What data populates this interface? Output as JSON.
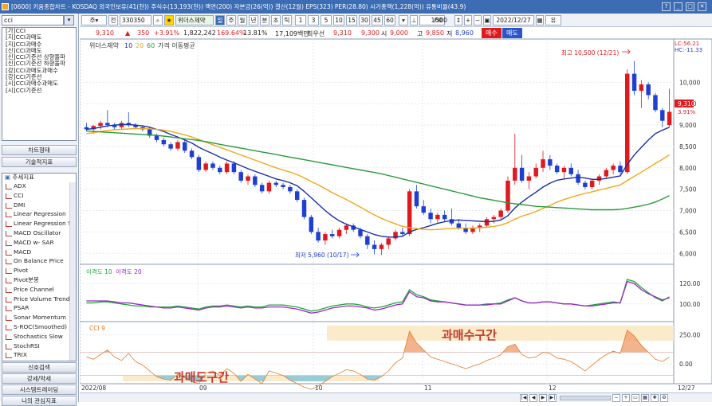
{
  "window": {
    "title": "[0600] 키움종합차트 - KOSDAQ 외국인보유(41(천)) 주식수(13,193(천)) 액면(200) 자본금(26(억)) 결산(12월) EPS(323) PER(28.80) 시가총액(1,228(억)) 유통비율(43.9)",
    "controls": [
      "?",
      "_",
      "□",
      "✕"
    ]
  },
  "sidebar": {
    "search_value": "cci",
    "condition_items": [
      "[가]CCI",
      "[지]CCI과매도",
      "[지]CCI과매수",
      "[신]CCI과매도",
      "[신]CCI기준선 상향돌파",
      "[신]CCI기준선 하향돌파",
      "[강]CCI과매도과매수",
      "[강]CCI기준선",
      "[시]CCI과매수과매도",
      "[시]CCI기준선"
    ],
    "chart_type_label": "차트형태",
    "tech_label": "기술적지표",
    "trend_header": "추세지표",
    "indicators": [
      "ADX",
      "CCI",
      "DMI",
      "Linear Regression",
      "Linear Regression Slope",
      "MACD Oscillator",
      "MACD w- SAR",
      "MACD",
      "On Balance Price",
      "Pivot",
      "Pivot분봉",
      "Price Channel",
      "Price Volume Trend",
      "PSAR",
      "Sonar Momentum",
      "S-ROC(Smoothed)",
      "Stochastics Slow",
      "StochRSI",
      "TRIX"
    ],
    "bottom_buttons": [
      "신호검색",
      "강세/약세",
      "시스템트레이딩",
      "나의 관심지표"
    ]
  },
  "toolbar": {
    "code": "330350",
    "name": "위더스제약",
    "periods": [
      "주",
      "월",
      "년",
      "분",
      "초",
      "틱"
    ],
    "intervals": [
      "1",
      "3",
      "5",
      "10",
      "15",
      "30",
      "45",
      "60"
    ],
    "count": "100",
    "count_total": "/500",
    "date": "2022/12/27",
    "right_label": "유"
  },
  "quote": {
    "price": "9,310",
    "change": "350",
    "change_pct": "+3.91%",
    "volume": "1,822,242",
    "vol_ratio": "169.64%",
    "turnover": "13.81%",
    "amount": "17,109백만",
    "ask_label": "최우선",
    "ask": "9,310",
    "bid": "9,300",
    "open_label": "시",
    "open": "9,000",
    "high_label": "고",
    "high": "9,850",
    "low_label": "저",
    "low": "8,960",
    "buy_label": "매수",
    "sell_label": "매도"
  },
  "price_panel": {
    "legend_name": "위더스제약",
    "legend_ma": [
      "10",
      "20",
      "60"
    ],
    "legend_ma_label": "가격 이동평균",
    "max_label": "최고 10,500 (12/21)",
    "min_label": "최저 5,960 (10/17)",
    "lc_label": "LC:56.21",
    "hc_label": "HC:-11.33",
    "current_price": "9,310",
    "current_pct": "3.91%",
    "ma_colors": {
      "ma10": "#1a2fa8",
      "ma20": "#f0a818",
      "ma60": "#2a9a3a"
    }
  },
  "disp_panel": {
    "legend": [
      "이격도 10",
      "이격도 20"
    ],
    "colors": {
      "d10": "#20a838",
      "d20": "#9b28c8"
    }
  },
  "cci_panel": {
    "legend": "CCI 9",
    "overbought_label": "과매수구간",
    "oversold_label": "과매도구간",
    "color": "#e07a28"
  },
  "x_labels": [
    "2022/08",
    "09",
    "10",
    "11",
    "12",
    "12/27"
  ],
  "chart_data": [
    {
      "type": "candlestick",
      "title": "",
      "ylim": [
        5800,
        10900
      ],
      "y_ticks": [
        "10,000",
        "9,500",
        "9,000",
        "8,500",
        "8,000",
        "7,500",
        "7,000",
        "6,500",
        "6,000"
      ],
      "candles": [
        [
          8950,
          9050,
          8850,
          8900
        ],
        [
          8900,
          9000,
          8800,
          8980
        ],
        [
          8980,
          9100,
          8900,
          9050
        ],
        [
          9050,
          9350,
          8950,
          9000
        ],
        [
          9000,
          9050,
          8900,
          8950
        ],
        [
          8950,
          9100,
          8900,
          9050
        ],
        [
          9050,
          9300,
          8950,
          9000
        ],
        [
          9000,
          9050,
          8900,
          8950
        ],
        [
          8950,
          9000,
          8850,
          8900
        ],
        [
          8900,
          8950,
          8700,
          8750
        ],
        [
          8750,
          8800,
          8600,
          8650
        ],
        [
          8650,
          8700,
          8500,
          8550
        ],
        [
          8550,
          8600,
          8400,
          8450
        ],
        [
          8450,
          8650,
          8400,
          8600
        ],
        [
          8600,
          8650,
          8350,
          8400
        ],
        [
          8400,
          8450,
          8200,
          8250
        ],
        [
          8250,
          8300,
          7900,
          7950
        ],
        [
          7950,
          8150,
          7900,
          8100
        ],
        [
          8100,
          8150,
          7950,
          8000
        ],
        [
          8000,
          8050,
          7850,
          7900
        ],
        [
          7900,
          8150,
          7850,
          8100
        ],
        [
          8100,
          8150,
          7850,
          7900
        ],
        [
          7900,
          7950,
          7650,
          7700
        ],
        [
          7700,
          7850,
          7600,
          7800
        ],
        [
          7800,
          7850,
          7550,
          7600
        ],
        [
          7600,
          7650,
          7400,
          7450
        ],
        [
          7450,
          7700,
          7400,
          7650
        ],
        [
          7650,
          7700,
          7550,
          7600
        ],
        [
          7600,
          7650,
          7500,
          7550
        ],
        [
          7550,
          7600,
          7400,
          7450
        ],
        [
          7450,
          7500,
          7200,
          7250
        ],
        [
          7250,
          7300,
          6800,
          6850
        ],
        [
          6850,
          6900,
          6450,
          6500
        ],
        [
          6500,
          6600,
          6250,
          6300
        ],
        [
          6300,
          6500,
          6200,
          6450
        ],
        [
          6450,
          6550,
          6350,
          6400
        ],
        [
          6400,
          6600,
          6350,
          6550
        ],
        [
          6550,
          6700,
          6450,
          6650
        ],
        [
          6650,
          6700,
          6500,
          6550
        ],
        [
          6550,
          6600,
          6350,
          6400
        ],
        [
          6400,
          6450,
          6100,
          6200
        ],
        [
          6200,
          6300,
          5980,
          6100
        ],
        [
          6100,
          6250,
          5960,
          6200
        ],
        [
          6200,
          6400,
          6100,
          6350
        ],
        [
          6350,
          6550,
          6300,
          6500
        ],
        [
          6500,
          6600,
          6400,
          6450
        ],
        [
          6450,
          7500,
          6400,
          7450
        ],
        [
          7450,
          7600,
          7050,
          7100
        ],
        [
          7100,
          7250,
          6900,
          6950
        ],
        [
          6950,
          7050,
          6700,
          6800
        ],
        [
          6800,
          6950,
          6700,
          6900
        ],
        [
          6900,
          7000,
          6750,
          6800
        ],
        [
          6800,
          7050,
          6650,
          6700
        ],
        [
          6700,
          6800,
          6550,
          6600
        ],
        [
          6600,
          6700,
          6450,
          6500
        ],
        [
          6500,
          6650,
          6450,
          6600
        ],
        [
          6600,
          6700,
          6500,
          6650
        ],
        [
          6650,
          6850,
          6600,
          6800
        ],
        [
          6800,
          6900,
          6700,
          6850
        ],
        [
          6850,
          7050,
          6800,
          7000
        ],
        [
          7000,
          7800,
          6950,
          7700
        ],
        [
          7700,
          8800,
          7600,
          8000
        ],
        [
          8000,
          8300,
          7650,
          7700
        ],
        [
          7700,
          7900,
          7500,
          7800
        ],
        [
          7800,
          8100,
          7750,
          8000
        ],
        [
          8000,
          8400,
          7900,
          8200
        ],
        [
          8200,
          8300,
          7950,
          8050
        ],
        [
          8050,
          8100,
          7850,
          7900
        ],
        [
          7900,
          8050,
          7750,
          8000
        ],
        [
          8000,
          8100,
          7800,
          7850
        ],
        [
          7850,
          7950,
          7600,
          7650
        ],
        [
          7650,
          7700,
          7500,
          7550
        ],
        [
          7550,
          7750,
          7500,
          7700
        ],
        [
          7700,
          7850,
          7600,
          7800
        ],
        [
          7800,
          8000,
          7750,
          7950
        ],
        [
          7950,
          8100,
          7850,
          8050
        ],
        [
          8050,
          8150,
          7850,
          7900
        ],
        [
          7900,
          10300,
          7850,
          10200
        ],
        [
          10200,
          10500,
          9700,
          9800
        ],
        [
          9800,
          10050,
          9400,
          9950
        ],
        [
          9950,
          10000,
          9600,
          9700
        ],
        [
          9700,
          9750,
          9300,
          9350
        ],
        [
          9350,
          9400,
          8950,
          9100
        ],
        [
          9000,
          9850,
          8960,
          9310
        ]
      ],
      "ma10": [
        8900,
        8920,
        8950,
        8980,
        9000,
        9010,
        9010,
        9000,
        8980,
        8950,
        8900,
        8850,
        8780,
        8720,
        8650,
        8580,
        8480,
        8400,
        8330,
        8250,
        8180,
        8120,
        8050,
        7980,
        7920,
        7860,
        7800,
        7740,
        7700,
        7650,
        7580,
        7450,
        7300,
        7150,
        7000,
        6870,
        6760,
        6680,
        6620,
        6560,
        6500,
        6440,
        6400,
        6380,
        6380,
        6400,
        6500,
        6560,
        6600,
        6650,
        6700,
        6740,
        6770,
        6780,
        6770,
        6760,
        6750,
        6740,
        6750,
        6780,
        6880,
        7060,
        7200,
        7320,
        7430,
        7550,
        7640,
        7710,
        7740,
        7760,
        7780,
        7760,
        7730,
        7730,
        7750,
        7780,
        7810,
        8080,
        8300,
        8480,
        8650,
        8800,
        8880,
        8950
      ],
      "ma20": [
        8800,
        8820,
        8850,
        8870,
        8890,
        8900,
        8910,
        8920,
        8920,
        8910,
        8900,
        8880,
        8850,
        8810,
        8770,
        8720,
        8660,
        8600,
        8540,
        8480,
        8420,
        8360,
        8300,
        8240,
        8180,
        8120,
        8060,
        8000,
        7950,
        7900,
        7840,
        7770,
        7680,
        7600,
        7510,
        7420,
        7340,
        7260,
        7170,
        7080,
        6990,
        6900,
        6820,
        6750,
        6690,
        6630,
        6600,
        6580,
        6560,
        6550,
        6560,
        6570,
        6580,
        6590,
        6590,
        6590,
        6600,
        6610,
        6630,
        6660,
        6720,
        6800,
        6870,
        6920,
        6980,
        7050,
        7120,
        7200,
        7260,
        7310,
        7360,
        7400,
        7440,
        7480,
        7520,
        7560,
        7600,
        7700,
        7800,
        7900,
        8000,
        8100,
        8200,
        8300
      ],
      "ma60": [
        8860,
        8850,
        8840,
        8830,
        8820,
        8810,
        8800,
        8790,
        8780,
        8770,
        8760,
        8740,
        8720,
        8700,
        8680,
        8660,
        8640,
        8610,
        8580,
        8550,
        8520,
        8490,
        8460,
        8430,
        8400,
        8370,
        8340,
        8310,
        8280,
        8250,
        8220,
        8190,
        8160,
        8130,
        8100,
        8070,
        8040,
        8010,
        7980,
        7950,
        7920,
        7890,
        7860,
        7820,
        7780,
        7740,
        7700,
        7660,
        7620,
        7580,
        7540,
        7500,
        7460,
        7420,
        7380,
        7340,
        7300,
        7270,
        7240,
        7210,
        7180,
        7160,
        7140,
        7120,
        7100,
        7090,
        7080,
        7070,
        7060,
        7050,
        7040,
        7030,
        7020,
        7020,
        7020,
        7020,
        7030,
        7050,
        7080,
        7110,
        7150,
        7200,
        7270,
        7350
      ]
    },
    {
      "type": "line",
      "title": "",
      "ylim": [
        85,
        135
      ],
      "y_ticks": [
        "120.00",
        "100.00"
      ],
      "series": [
        {
          "name": "이격도 10",
          "values": [
            101,
            101,
            102,
            102,
            101,
            100,
            99,
            98,
            98,
            97,
            97,
            97,
            97,
            98,
            97,
            96,
            95,
            97,
            98,
            98,
            99,
            98,
            97,
            98,
            97,
            97,
            99,
            99,
            99,
            98,
            97,
            95,
            93,
            94,
            96,
            98,
            99,
            100,
            100,
            99,
            97,
            96,
            97,
            99,
            101,
            102,
            114,
            109,
            107,
            104,
            103,
            102,
            101,
            100,
            99,
            99,
            99,
            100,
            100,
            101,
            104,
            106,
            103,
            101,
            101,
            102,
            102,
            101,
            100,
            100,
            99,
            98,
            99,
            100,
            101,
            102,
            101,
            124,
            122,
            116,
            111,
            106,
            103,
            107
          ]
        },
        {
          "name": "이격도 20",
          "values": [
            103,
            103,
            103,
            103,
            102,
            101,
            101,
            100,
            99,
            98,
            97,
            96,
            96,
            97,
            96,
            95,
            94,
            96,
            97,
            97,
            98,
            97,
            96,
            97,
            96,
            96,
            97,
            97,
            97,
            96,
            95,
            93,
            91,
            92,
            94,
            96,
            97,
            98,
            98,
            97,
            96,
            94,
            95,
            97,
            99,
            100,
            112,
            107,
            106,
            103,
            102,
            102,
            101,
            100,
            99,
            99,
            99,
            99,
            100,
            100,
            103,
            106,
            103,
            101,
            101,
            102,
            102,
            101,
            100,
            100,
            99,
            98,
            98,
            99,
            100,
            101,
            101,
            122,
            120,
            114,
            110,
            107,
            104,
            106
          ]
        }
      ]
    },
    {
      "type": "area",
      "title": "",
      "ylim": [
        -150,
        330
      ],
      "y_ticks": [
        "250.00",
        "0.00"
      ],
      "bands": {
        "overbought": [
          200,
          330
        ],
        "oversold": [
          -150,
          -100
        ]
      },
      "series": [
        {
          "name": "CCI 9",
          "values": [
            60,
            40,
            80,
            120,
            60,
            30,
            90,
            20,
            -10,
            -60,
            -110,
            -130,
            -140,
            -90,
            -120,
            -150,
            -170,
            -80,
            -60,
            -100,
            -40,
            -80,
            -150,
            -90,
            -130,
            -170,
            -60,
            -80,
            -100,
            -140,
            -170,
            -200,
            -220,
            -190,
            -150,
            -110,
            -80,
            -50,
            -60,
            -90,
            -130,
            -140,
            -110,
            -60,
            10,
            50,
            280,
            180,
            120,
            60,
            40,
            20,
            0,
            -20,
            -40,
            -20,
            0,
            30,
            50,
            80,
            150,
            170,
            80,
            50,
            60,
            100,
            90,
            50,
            40,
            20,
            -20,
            -60,
            -10,
            40,
            80,
            110,
            90,
            290,
            240,
            160,
            100,
            40,
            20,
            60
          ]
        }
      ]
    }
  ]
}
